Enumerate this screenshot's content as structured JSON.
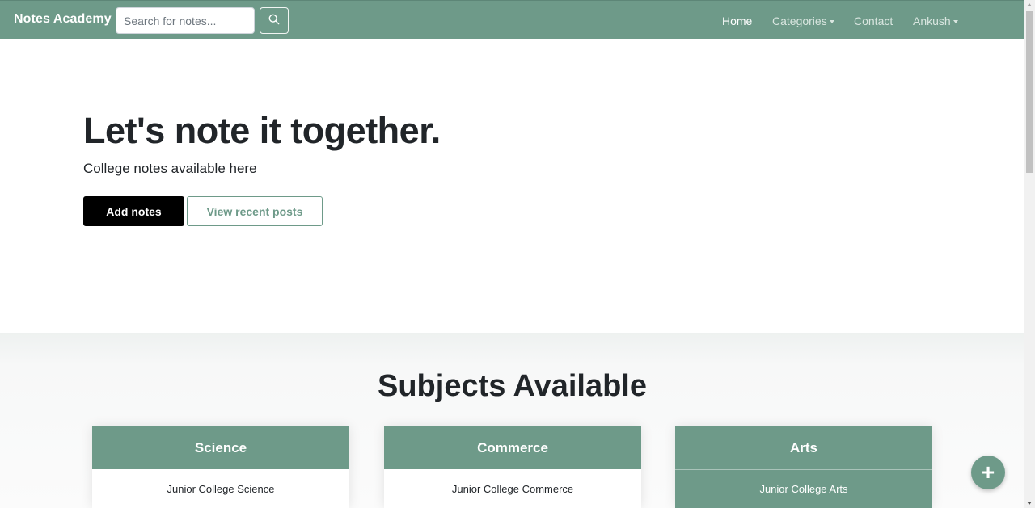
{
  "navbar": {
    "brand": "Notes Academy",
    "search": {
      "placeholder": "Search for notes...",
      "value": "",
      "button_icon": "search-icon"
    },
    "links": [
      {
        "label": "Home",
        "active": true,
        "dropdown": false
      },
      {
        "label": "Categories",
        "active": false,
        "dropdown": true
      },
      {
        "label": "Contact",
        "active": false,
        "dropdown": false
      },
      {
        "label": "Ankush",
        "active": false,
        "dropdown": true
      }
    ]
  },
  "hero": {
    "title": "Let's note it together.",
    "subtitle": "College notes available here",
    "primary_button": "Add notes",
    "secondary_button": "View recent posts"
  },
  "subjects": {
    "title": "Subjects Available",
    "cards": [
      {
        "header": "Science",
        "item": "Junior College Science"
      },
      {
        "header": "Commerce",
        "item": "Junior College Commerce"
      },
      {
        "header": "Arts",
        "item": "Junior College Arts"
      }
    ]
  },
  "fab": {
    "icon": "plus-icon",
    "glyph": "+"
  },
  "colors": {
    "brand": "#6e9a89",
    "primary_button": "#000000",
    "text": "#212529"
  }
}
